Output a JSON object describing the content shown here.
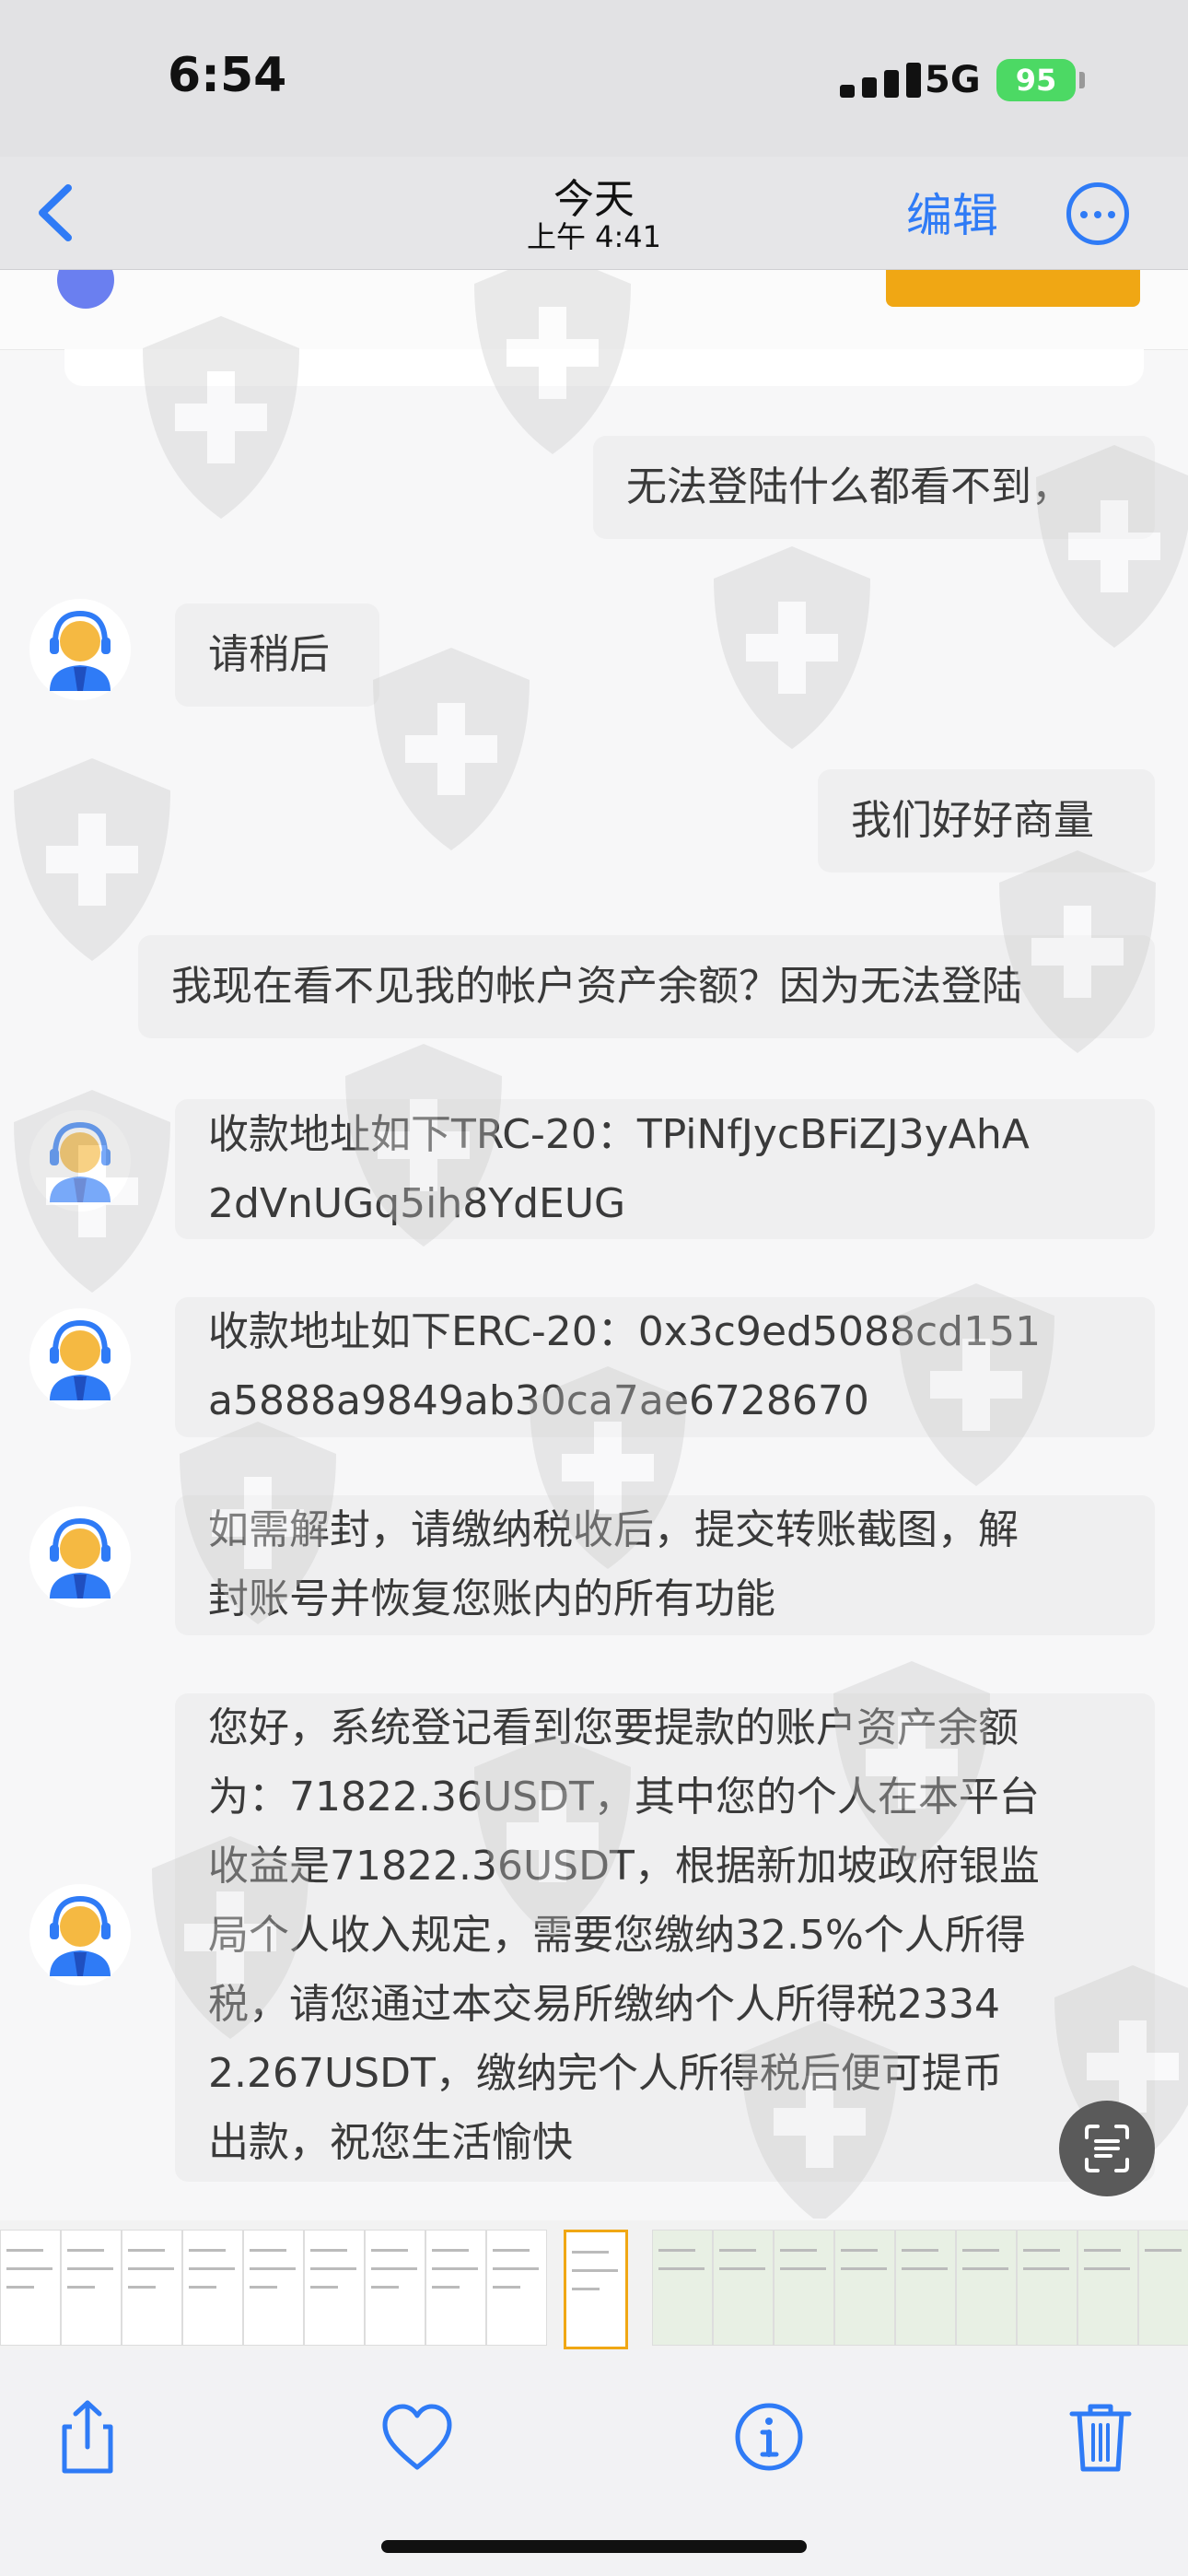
{
  "status_bar": {
    "time": "6:54",
    "network": "5G",
    "battery": "95"
  },
  "nav": {
    "title": "今天",
    "subtitle": "上午 4:41",
    "edit_label": "编辑"
  },
  "messages": [
    {
      "side": "right",
      "text": "无法登陆什么都看不到，"
    },
    {
      "side": "left",
      "text": "请稍后"
    },
    {
      "side": "right",
      "text": "我们好好商量"
    },
    {
      "side": "right",
      "text": "我现在看不见我的帐户资产余额？因为无法登陆"
    },
    {
      "side": "left",
      "lines": [
        "收款地址如下TRC-20：TPiNfJycBFiZJ3yAhA",
        "2dVnUGq5ih8YdEUG"
      ]
    },
    {
      "side": "left",
      "lines": [
        "收款地址如下ERC-20：0x3c9ed5088cd151",
        "a5888a9849ab30ca7ae6728670"
      ]
    },
    {
      "side": "left",
      "lines": [
        "如需解封，请缴纳税收后，提交转账截图，解",
        "封账号并恢复您账内的所有功能"
      ]
    },
    {
      "side": "left",
      "lines": [
        "您好，系统登记看到您要提款的账户资产余额",
        "为：71822.36USDT，其中您的个人在本平台",
        "收益是71822.36USDT，根据新加坡政府银监",
        "局个人收入规定，需要您缴纳32.5%个人所得",
        "税，请您通过本交易所缴纳个人所得税2334",
        "2.267USDT，缴纳完个人所得税后便可提币",
        "出款，祝您生活愉快"
      ]
    }
  ],
  "toolbar": {
    "icons": [
      "share-icon",
      "heart-icon",
      "info-icon",
      "trash-icon"
    ]
  },
  "colors": {
    "accent": "#2f7bf6",
    "battery": "#4cd964",
    "bubble": "#efeff0"
  }
}
